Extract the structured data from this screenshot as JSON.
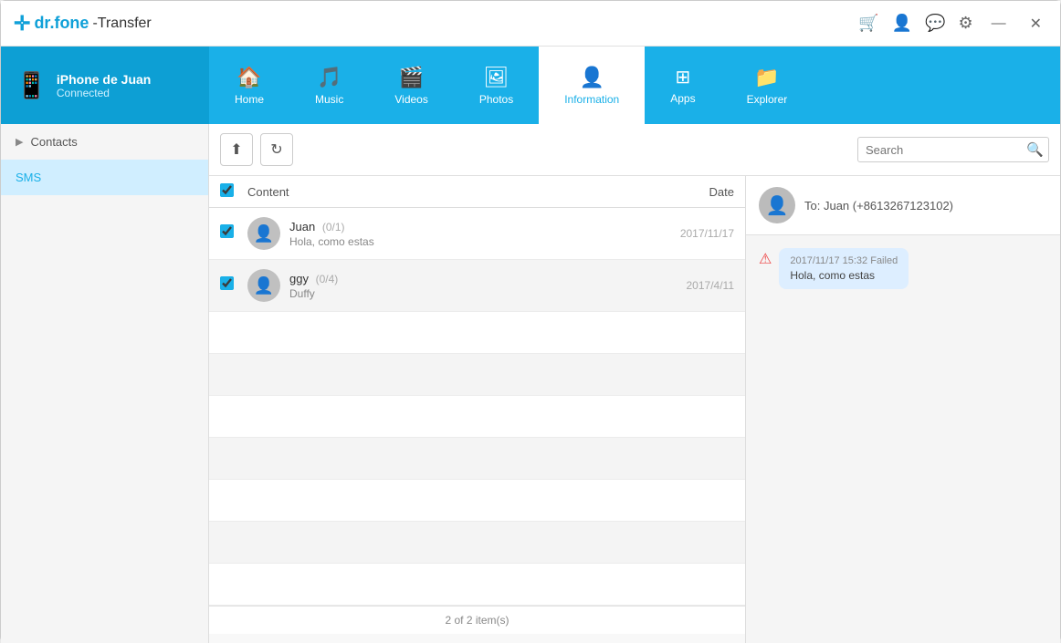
{
  "titlebar": {
    "app_name": "dr.fone",
    "app_suffix": "-Transfer",
    "icons": {
      "cart": "🛒",
      "user": "👤",
      "chat": "💬",
      "settings": "⚙",
      "minimize": "—",
      "close": "✕"
    }
  },
  "navbar": {
    "device": {
      "name": "iPhone de Juan",
      "status": "Connected"
    },
    "tabs": [
      {
        "id": "home",
        "label": "Home",
        "icon": "🏠"
      },
      {
        "id": "music",
        "label": "Music",
        "icon": "🎵"
      },
      {
        "id": "videos",
        "label": "Videos",
        "icon": "🎬"
      },
      {
        "id": "photos",
        "label": "Photos",
        "icon": "🖼"
      },
      {
        "id": "information",
        "label": "Information",
        "icon": "👤",
        "active": true
      },
      {
        "id": "apps",
        "label": "Apps",
        "icon": "⊞"
      },
      {
        "id": "explorer",
        "label": "Explorer",
        "icon": "📁"
      }
    ]
  },
  "sidebar": {
    "items": [
      {
        "id": "contacts",
        "label": "Contacts",
        "has_arrow": true,
        "active": false
      },
      {
        "id": "sms",
        "label": "SMS",
        "has_arrow": false,
        "active": true
      }
    ]
  },
  "toolbar": {
    "export_icon": "⬆",
    "refresh_icon": "↻",
    "search_placeholder": "Search"
  },
  "sms_list": {
    "columns": {
      "content": "Content",
      "date": "Date"
    },
    "messages": [
      {
        "id": 1,
        "name": "Juan",
        "count": "(0/1)",
        "preview": "Hola, como estas",
        "date": "2017/11/17",
        "checked": true
      },
      {
        "id": 2,
        "name": "ggy",
        "count": "(0/4)",
        "preview": "Duffy",
        "date": "2017/4/11",
        "checked": true
      }
    ],
    "footer": "2 of 2 item(s)"
  },
  "detail": {
    "to_label": "To:",
    "to_number": "Juan (+8613267123102)",
    "messages": [
      {
        "meta": "2017/11/17 15:32 Failed",
        "text": "Hola, como estas",
        "has_error": true
      }
    ]
  }
}
